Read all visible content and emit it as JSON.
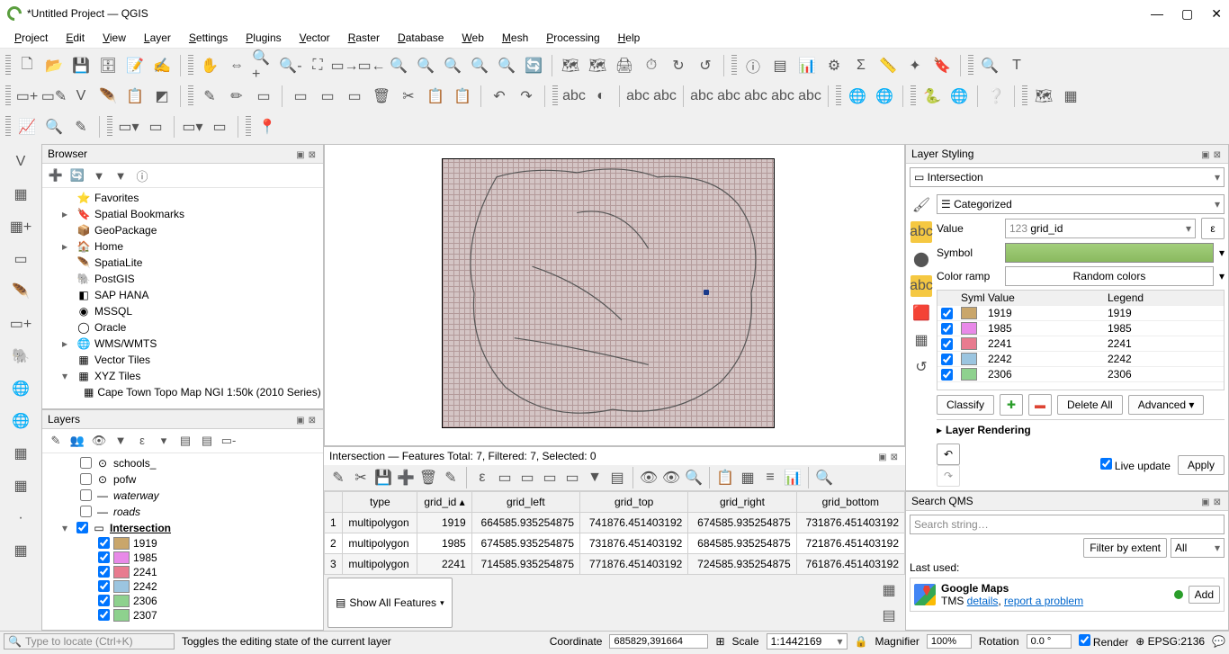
{
  "window": {
    "title": "*Untitled Project — QGIS"
  },
  "menu": [
    "Project",
    "Edit",
    "View",
    "Layer",
    "Settings",
    "Plugins",
    "Vector",
    "Raster",
    "Database",
    "Web",
    "Mesh",
    "Processing",
    "Help"
  ],
  "browser": {
    "title": "Browser",
    "items": [
      {
        "caret": "",
        "icon": "⭐",
        "label": "Favorites",
        "indent": 1
      },
      {
        "caret": "▸",
        "icon": "🔖",
        "label": "Spatial Bookmarks",
        "indent": 1
      },
      {
        "caret": "",
        "icon": "📦",
        "label": "GeoPackage",
        "indent": 1
      },
      {
        "caret": "▸",
        "icon": "🏠",
        "label": "Home",
        "indent": 1
      },
      {
        "caret": "",
        "icon": "🪶",
        "label": "SpatiaLite",
        "indent": 1
      },
      {
        "caret": "",
        "icon": "🐘",
        "label": "PostGIS",
        "indent": 1
      },
      {
        "caret": "",
        "icon": "◧",
        "label": "SAP HANA",
        "indent": 1
      },
      {
        "caret": "",
        "icon": "◉",
        "label": "MSSQL",
        "indent": 1
      },
      {
        "caret": "",
        "icon": "◯",
        "label": "Oracle",
        "indent": 1
      },
      {
        "caret": "▸",
        "icon": "🌐",
        "label": "WMS/WMTS",
        "indent": 1
      },
      {
        "caret": "",
        "icon": "▦",
        "label": "Vector Tiles",
        "indent": 1
      },
      {
        "caret": "▾",
        "icon": "▦",
        "label": "XYZ Tiles",
        "indent": 1
      },
      {
        "caret": "",
        "icon": "▦",
        "label": "Cape Town Topo Map NGI 1:50k (2010 Series)",
        "indent": 2
      }
    ]
  },
  "layers": {
    "title": "Layers",
    "items": [
      {
        "cb": false,
        "icon": "⊙",
        "label": "schools_",
        "indent": 1,
        "color": ""
      },
      {
        "cb": false,
        "icon": "⊙",
        "label": "pofw",
        "indent": 1,
        "color": ""
      },
      {
        "cb": false,
        "icon": "—",
        "label": "waterway",
        "italic": true,
        "indent": 1,
        "color": ""
      },
      {
        "cb": false,
        "icon": "—",
        "label": "roads",
        "italic": true,
        "indent": 1,
        "color": ""
      },
      {
        "cb": true,
        "icon": "▭",
        "label": "Intersection",
        "bold": true,
        "indent": 0,
        "caret": "▾",
        "color": ""
      },
      {
        "cb": true,
        "icon": "",
        "label": "1919",
        "indent": 2,
        "color": "#c9a66b"
      },
      {
        "cb": true,
        "icon": "",
        "label": "1985",
        "indent": 2,
        "color": "#e889e8"
      },
      {
        "cb": true,
        "icon": "",
        "label": "2241",
        "indent": 2,
        "color": "#e87b8f"
      },
      {
        "cb": true,
        "icon": "",
        "label": "2242",
        "indent": 2,
        "color": "#9bc5e0"
      },
      {
        "cb": true,
        "icon": "",
        "label": "2306",
        "indent": 2,
        "color": "#8ed18e"
      },
      {
        "cb": true,
        "icon": "",
        "label": "2307",
        "indent": 2,
        "color": "#8ed18e"
      }
    ]
  },
  "attribute": {
    "title": "Intersection — Features Total: 7, Filtered: 7, Selected: 0",
    "columns": [
      "",
      "type",
      "grid_id",
      "grid_left",
      "grid_top",
      "grid_right",
      "grid_bottom"
    ],
    "rows": [
      [
        "1",
        "multipolygon",
        "1919",
        "664585.935254875",
        "741876.451403192",
        "674585.935254875",
        "731876.451403192"
      ],
      [
        "2",
        "multipolygon",
        "1985",
        "674585.935254875",
        "731876.451403192",
        "684585.935254875",
        "721876.451403192"
      ],
      [
        "3",
        "multipolygon",
        "2241",
        "714585.935254875",
        "771876.451403192",
        "724585.935254875",
        "761876.451403192"
      ]
    ],
    "footer_btn": "Show All Features"
  },
  "styling": {
    "title": "Layer Styling",
    "layer": "Intersection",
    "renderer": "Categorized",
    "value_label": "Value",
    "value_field": "grid_id",
    "value_prefix": "123",
    "symbol_label": "Symbol",
    "ramp_label": "Color ramp",
    "ramp_value": "Random colors",
    "cat_head": [
      "Symbol",
      "Value",
      "Legend"
    ],
    "categories": [
      {
        "color": "#c9a66b",
        "value": "1919",
        "legend": "1919"
      },
      {
        "color": "#e889e8",
        "value": "1985",
        "legend": "1985"
      },
      {
        "color": "#e87b8f",
        "value": "2241",
        "legend": "2241"
      },
      {
        "color": "#9bc5e0",
        "value": "2242",
        "legend": "2242"
      },
      {
        "color": "#8ed18e",
        "value": "2306",
        "legend": "2306"
      }
    ],
    "classify": "Classify",
    "delete_all": "Delete All",
    "advanced": "Advanced",
    "rendering": "Layer Rendering",
    "live_update": "Live update",
    "apply": "Apply"
  },
  "qms": {
    "title": "Search QMS",
    "search_placeholder": "Search string…",
    "filter_extent": "Filter by extent",
    "all": "All",
    "last_used": "Last used:",
    "service": {
      "name": "Google Maps",
      "sub": "TMS ",
      "details": "details",
      "report": "report a problem",
      "add": "Add"
    }
  },
  "status": {
    "locate_placeholder": "Type to locate (Ctrl+K)",
    "hint": "Toggles the editing state of the current layer",
    "coord_label": "Coordinate",
    "coord": "685829,391664",
    "scale_label": "Scale",
    "scale": "1:1442169",
    "mag_label": "Magnifier",
    "mag": "100%",
    "rot_label": "Rotation",
    "rot": "0.0 °",
    "render": "Render",
    "epsg": "EPSG:2136"
  }
}
